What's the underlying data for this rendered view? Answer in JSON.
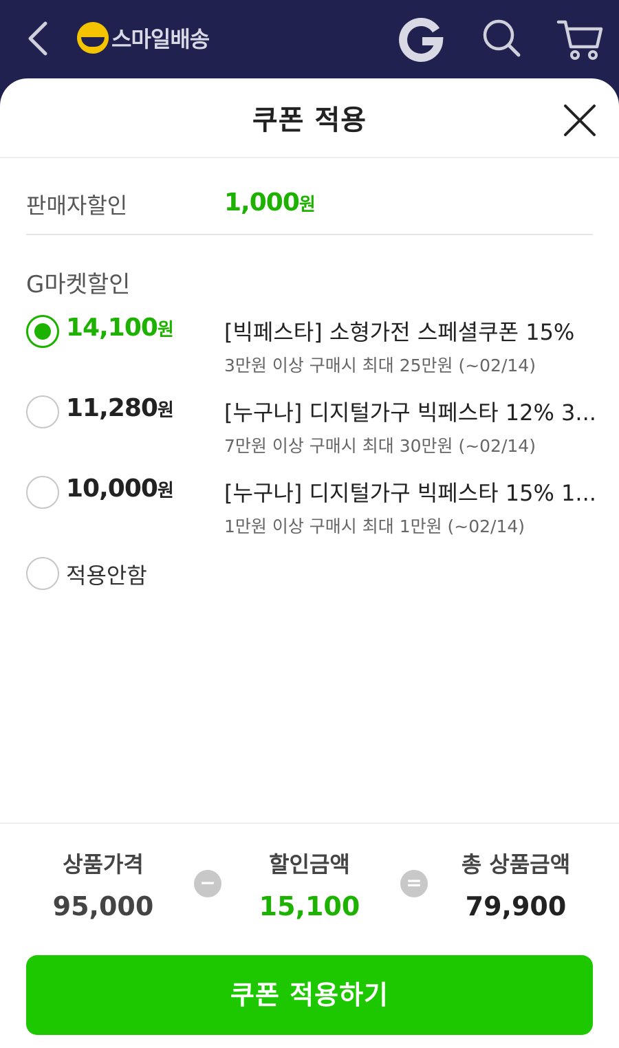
{
  "appbar": {
    "brand": "스마일배송",
    "icons": {
      "back": "back-arrow-icon",
      "g": "gmarket-g-icon",
      "search": "search-icon",
      "cart": "cart-icon"
    }
  },
  "sheet": {
    "title": "쿠폰 적용",
    "close_icon": "close-icon"
  },
  "seller_discount": {
    "label": "판매자할인",
    "amount": "1,000",
    "unit": "원"
  },
  "gmarket_discount": {
    "label": "G마켓할인",
    "coupons": [
      {
        "amount": "14,100",
        "unit": "원",
        "name": "[빅페스타] 소형가전 스페셜쿠폰 15%",
        "condition": "3만원 이상 구매시 최대 25만원 (~02/14)",
        "selected": true
      },
      {
        "amount": "11,280",
        "unit": "원",
        "name": "[누구나] 디지털가구 빅페스타 12% 3...",
        "condition": "7만원 이상 구매시 최대 30만원 (~02/14)",
        "selected": false
      },
      {
        "amount": "10,000",
        "unit": "원",
        "name": "[누구나] 디지털가구 빅페스타 15% 1...",
        "condition": "1만원 이상 구매시 최대 1만원 (~02/14)",
        "selected": false
      }
    ],
    "no_apply_label": "적용안함"
  },
  "summary": {
    "price_label": "상품가격",
    "price_value": "95,000",
    "minus": "−",
    "discount_label": "할인금액",
    "discount_value": "15,100",
    "equals": "=",
    "total_label": "총 상품금액",
    "total_value": "79,900"
  },
  "apply_button": "쿠폰 적용하기",
  "colors": {
    "accent": "#1ec800",
    "appbar": "#212150",
    "logo": "#f5c400"
  }
}
